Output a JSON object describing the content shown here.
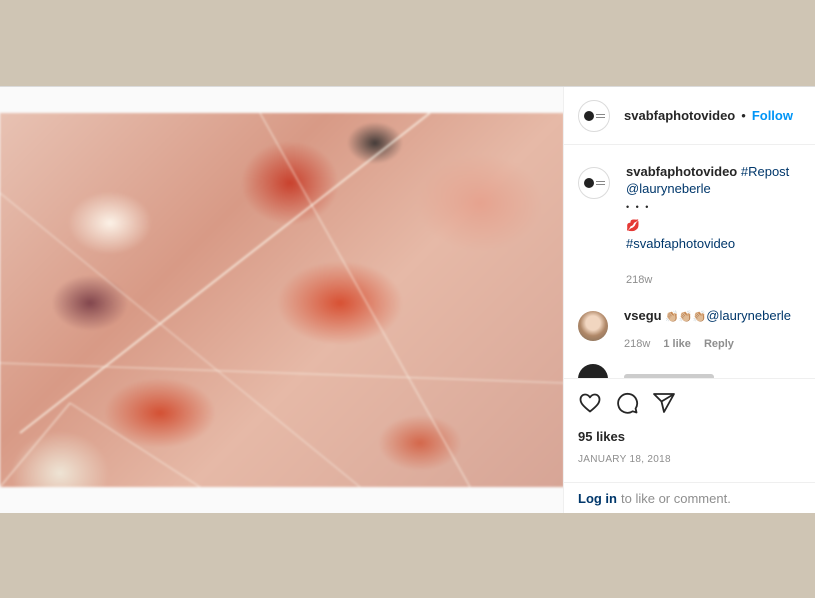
{
  "post": {
    "username": "svabfaphotovideo",
    "follow_label": "Follow",
    "separator": "•"
  },
  "caption": {
    "username": "svabfaphotovideo",
    "hashtag_repost": "#Repost",
    "mention": "@lauryneberle",
    "dots": "• • •",
    "emoji": "💋",
    "hashtag": "#svabfaphotovideo",
    "time": "218w"
  },
  "comment": {
    "username": "vsegu",
    "emoji": "👏🏼👏🏼👏🏼",
    "mention": "@lauryneberle",
    "time": "218w",
    "likes": "1 like",
    "reply": "Reply"
  },
  "actions": {
    "like_icon": "heart-icon",
    "comment_icon": "comment-icon",
    "share_icon": "paper-plane-icon"
  },
  "likes_text": "95 likes",
  "date": "JANUARY 18, 2018",
  "login": {
    "link": "Log in",
    "text": "to like or comment."
  }
}
